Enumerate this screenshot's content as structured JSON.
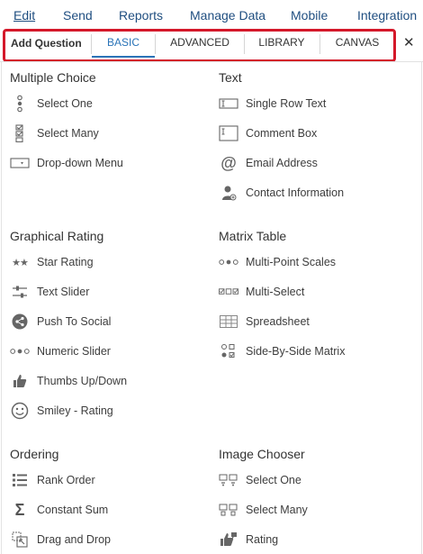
{
  "menubar": {
    "items": [
      "Edit",
      "Send",
      "Reports",
      "Manage Data",
      "Mobile",
      "Integration"
    ]
  },
  "tabs": {
    "header_label": "Add Question",
    "items": [
      "BASIC",
      "ADVANCED",
      "LIBRARY",
      "CANVAS"
    ],
    "selected": "BASIC",
    "close_icon": "close-icon"
  },
  "colors": {
    "accent": "#2a74b8",
    "highlight_box": "#d4182a",
    "menu_link": "#1f4e80"
  },
  "sections": {
    "multiple_choice": {
      "title": "Multiple Choice",
      "items": [
        {
          "label": "Select One",
          "icon": "radio-stack-icon"
        },
        {
          "label": "Select Many",
          "icon": "checkbox-stack-icon"
        },
        {
          "label": "Drop-down Menu",
          "icon": "dropdown-icon"
        }
      ]
    },
    "text": {
      "title": "Text",
      "items": [
        {
          "label": "Single Row Text",
          "icon": "text-row-icon"
        },
        {
          "label": "Comment Box",
          "icon": "comment-box-icon"
        },
        {
          "label": "Email Address",
          "icon": "at-icon"
        },
        {
          "label": "Contact Information",
          "icon": "contact-person-icon"
        }
      ]
    },
    "graphical_rating": {
      "title": "Graphical Rating",
      "items": [
        {
          "label": "Star Rating",
          "icon": "stars-icon"
        },
        {
          "label": "Text Slider",
          "icon": "sliders-icon"
        },
        {
          "label": "Push To Social",
          "icon": "share-icon"
        },
        {
          "label": "Numeric Slider",
          "icon": "dots-scale-icon"
        },
        {
          "label": "Thumbs Up/Down",
          "icon": "thumbs-up-icon"
        },
        {
          "label": "Smiley - Rating",
          "icon": "smiley-icon"
        }
      ]
    },
    "matrix_table": {
      "title": "Matrix Table",
      "items": [
        {
          "label": "Multi-Point Scales",
          "icon": "multi-point-icon"
        },
        {
          "label": "Multi-Select",
          "icon": "multi-select-icon"
        },
        {
          "label": "Spreadsheet",
          "icon": "spreadsheet-icon"
        },
        {
          "label": "Side-By-Side Matrix",
          "icon": "side-by-side-icon"
        }
      ]
    },
    "ordering": {
      "title": "Ordering",
      "items": [
        {
          "label": "Rank Order",
          "icon": "rank-list-icon"
        },
        {
          "label": "Constant Sum",
          "icon": "sigma-icon"
        },
        {
          "label": "Drag and Drop",
          "icon": "drag-drop-icon"
        }
      ]
    },
    "image_chooser": {
      "title": "Image Chooser",
      "items": [
        {
          "label": "Select One",
          "icon": "image-grid-icon"
        },
        {
          "label": "Select Many",
          "icon": "image-grid-multi-icon"
        },
        {
          "label": "Rating",
          "icon": "image-rating-icon"
        }
      ]
    }
  }
}
